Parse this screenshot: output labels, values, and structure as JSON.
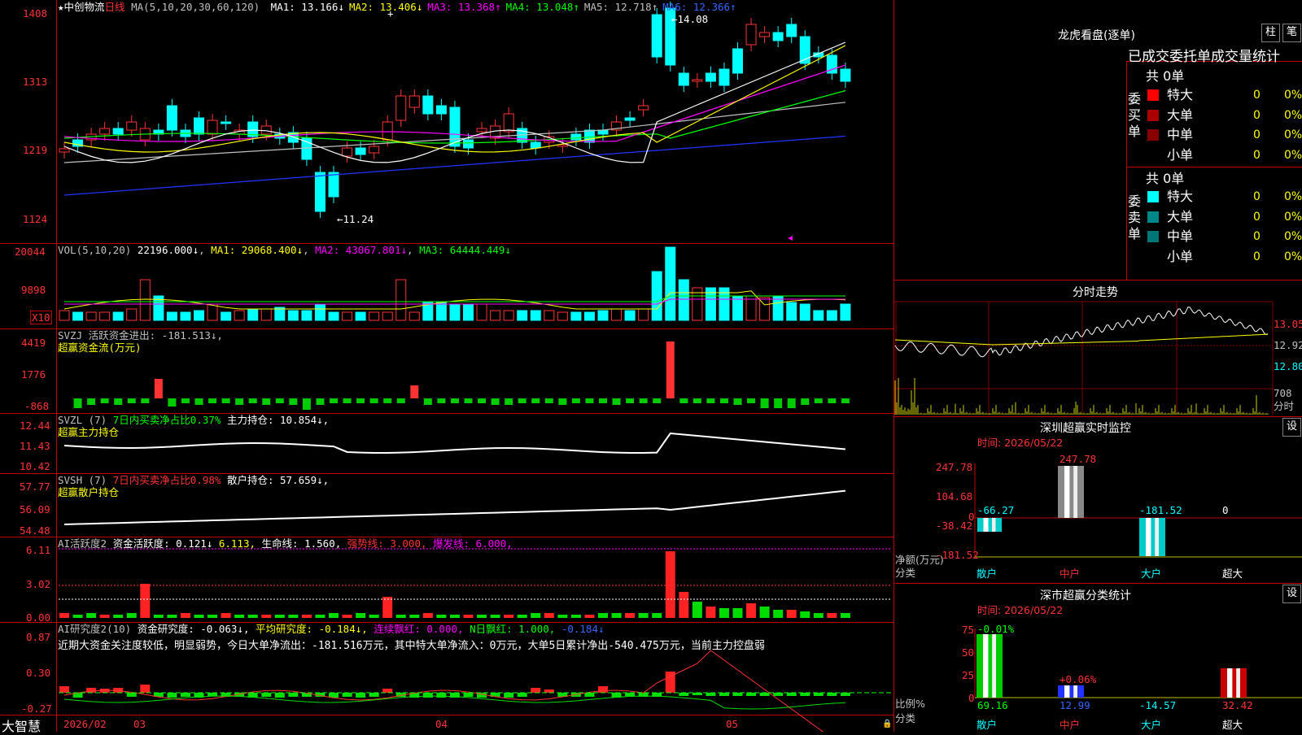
{
  "header": {
    "star": "★",
    "stock_name": "中创物流",
    "period": "日线",
    "ma_label": "MA(5,10,20,30,60,120)",
    "ma": [
      {
        "name": "MA1:",
        "val": "13.166↓",
        "c": "white"
      },
      {
        "name": "MA2:",
        "val": "13.406↓",
        "c": "yellow"
      },
      {
        "name": "MA3:",
        "val": "13.368↑",
        "c": "magenta"
      },
      {
        "name": "MA4:",
        "val": "13.048↑",
        "c": "green"
      },
      {
        "name": "MA5:",
        "val": "12.718↑",
        "c": "gray"
      },
      {
        "name": "MA6:",
        "val": "12.366↑",
        "c": "blue"
      }
    ],
    "high_mark": "←14.08",
    "low_mark": "←11.24"
  },
  "price_axis": [
    "1408",
    "1313",
    "1219",
    "1124"
  ],
  "vol": {
    "label": "VOL(5,10,20)",
    "val": "22196.000↓",
    "ma1": "MA1: 29068.400↓",
    "ma2": "MA2: 43067.801↓",
    "ma3": "MA3: 64444.449↓",
    "axis": [
      "20044",
      "9898"
    ],
    "unit": "X10"
  },
  "svzj": {
    "l1": "SVZJ  活跃资金进出: -181.513↓,",
    "l2": "超赢资金流(万元)",
    "axis": [
      "4419",
      "1776",
      "-868"
    ]
  },
  "svzl": {
    "l1a": "SVZL (7)",
    "l1b": "7日内买卖净占比0.37%",
    "l1c": "主力持仓: 10.854↓,",
    "l2": "超赢主力持仓",
    "axis": [
      "12.44",
      "11.43",
      "10.42"
    ]
  },
  "svsh": {
    "l1a": "SVSH (7)",
    "l1b": "7日内买卖净占比0.98%",
    "l1c": "散户持仓: 57.659↓,",
    "l2": "超赢散户持仓",
    "axis": [
      "57.77",
      "56.09",
      "54.48"
    ]
  },
  "ai1": {
    "a": "AI活跃度2",
    "b": "资金活跃度: 0.121↓",
    "c": "6.113,",
    "d": "生命线: 1.560,",
    "e": "强势线: 3.000,",
    "f": "爆发线: 6.000,",
    "axis": [
      "6.11",
      "3.02",
      "0.00"
    ]
  },
  "ai2": {
    "a": "AI研究度2(10)",
    "b": "资金研究度: -0.063↓,",
    "c": "平均研究度: -0.184↓,",
    "d": "连续飘红: 0.000,",
    "e": "N日飘红: 1.000,",
    "f": "-0.184↓",
    "comment": "近期大资金关注度较低，明显弱势，今日大单净流出：-181.516万元，其中特大单净流入：0万元，大单5日累计净出-540.475万元，当前主力控盘弱",
    "axis": [
      "0.87",
      "0.30",
      "-0.27"
    ]
  },
  "xaxis": {
    "brand": "大智慧",
    "labels": [
      "2026/02",
      "03",
      "04",
      "05"
    ]
  },
  "dragon": {
    "title": "龙虎看盘(逐单)",
    "btn1": "柱",
    "btn2": "笔",
    "tab_header": "已成交委托单成交量统计",
    "buy": {
      "label": "委买单",
      "total": "共 0单",
      "rows": [
        {
          "n": "特大",
          "v": "0",
          "p": "0%",
          "c": "#ff0000"
        },
        {
          "n": "大单",
          "v": "0",
          "p": "0%",
          "c": "#aa0000"
        },
        {
          "n": "中单",
          "v": "0",
          "p": "0%",
          "c": "#880000"
        },
        {
          "n": "小单",
          "v": "0",
          "p": "0%",
          "c": "#000"
        }
      ]
    },
    "sell": {
      "label": "委卖单",
      "total": "共 0单",
      "rows": [
        {
          "n": "特大",
          "v": "0",
          "p": "0%",
          "c": "#00ffff"
        },
        {
          "n": "大单",
          "v": "0",
          "p": "0%",
          "c": "#008888"
        },
        {
          "n": "中单",
          "v": "0",
          "p": "0%",
          "c": "#007777"
        },
        {
          "n": "小单",
          "v": "0",
          "p": "0%",
          "c": "#000"
        }
      ]
    }
  },
  "intraday": {
    "title": "分时走势",
    "p1": "13.05",
    "p2": "12.92",
    "p3": "12.80",
    "vol": "708",
    "unit": "分时"
  },
  "sz_monitor": {
    "title": "深圳超赢实时监控",
    "btn": "设",
    "time": "时间: 2026/05/22",
    "axis": [
      "247.78",
      "104.68",
      "0",
      "-38.42",
      "-181.52"
    ],
    "net_label": "净额(万元)",
    "cat_label": "分类",
    "cats": [
      "散户",
      "中户",
      "大户",
      "超大"
    ],
    "vals": [
      "-66.27",
      "247.78",
      "-181.52",
      "0"
    ]
  },
  "sz_class": {
    "title": "深市超赢分类统计",
    "btn": "设",
    "time": "时间: 2026/05/22",
    "axis": [
      "75",
      "50",
      "25",
      "0"
    ],
    "ratio_label": "比例%",
    "cat_label": "分类",
    "cats": [
      "散户",
      "中户",
      "大户",
      "超大"
    ],
    "vals": [
      "69.16",
      "12.99",
      "-14.57",
      "32.42"
    ],
    "deltas": [
      "-0.01%",
      "+0.06%"
    ]
  }
}
